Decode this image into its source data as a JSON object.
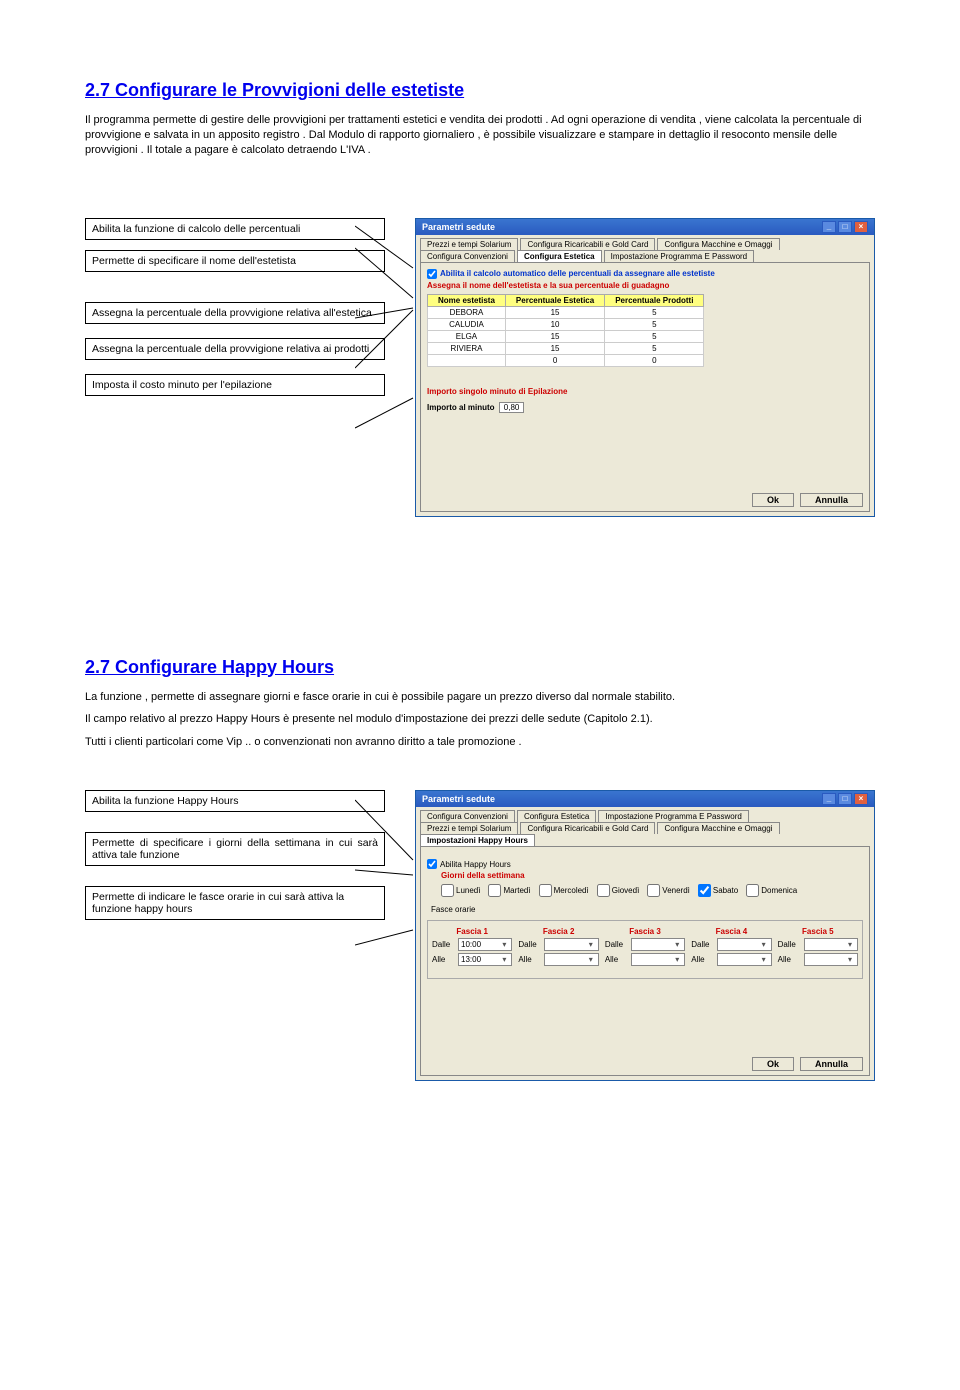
{
  "section1": {
    "heading": "2.7 Configurare le Provvigioni delle estetiste",
    "para": "Il programma permette di gestire delle provvigioni per trattamenti estetici e vendita dei prodotti . Ad ogni operazione di vendita , viene calcolata la percentuale di provvigione e salvata in un apposito registro . Dal Modulo di rapporto giornaliero , è possibile  visualizzare e stampare in dettaglio il resoconto mensile delle provvigioni . Il totale a pagare è calcolato detraendo L'IVA .",
    "callouts": {
      "c1": "Abilita la funzione di calcolo delle percentuali",
      "c2": "Permette di specificare il nome dell'estetista",
      "c3": "Assegna la percentuale della provvigione relativa all'estetica",
      "c4": "Assegna la percentuale della provvigione relativa ai prodotti",
      "c5": "Imposta il costo minuto per l'epilazione"
    },
    "win": {
      "title": "Parametri sedute",
      "tabsTop": [
        "Prezzi e tempi Solarium",
        "Configura Ricaricabili e Gold Card",
        "Configura Macchine e Omaggi"
      ],
      "tabsBottom": [
        "Configura Convenzioni",
        "Configura Estetica",
        "Impostazione Programma E Password"
      ],
      "activeTab": "Configura Estetica",
      "chk": "Abilita il calcolo automatico delle percentuali da assegnare alle estetiste",
      "redline": "Assegna il nome dell'estetista e la sua percentuale di guadagno",
      "th1": "Nome estetista",
      "th2": "Percentuale Estetica",
      "th3": "Percentuale Prodotti",
      "rows": [
        {
          "n": "DEBORA",
          "e": "15",
          "p": "5"
        },
        {
          "n": "CALUDIA",
          "e": "10",
          "p": "5"
        },
        {
          "n": "ELGA",
          "e": "15",
          "p": "5"
        },
        {
          "n": "RIVIERA",
          "e": "15",
          "p": "5"
        },
        {
          "n": "",
          "e": "0",
          "p": "0"
        }
      ],
      "importoTitle": "Importo singolo minuto di Epilazione",
      "importoLbl": "Importo al minuto",
      "importoVal": "0,80",
      "ok": "Ok",
      "cancel": "Annulla"
    }
  },
  "section2": {
    "heading": "2.7 Configurare Happy Hours",
    "para1": "La funzione , permette di assegnare giorni e fasce orarie in cui è possibile pagare un prezzo diverso dal normale stabilito.",
    "para2": "Il campo relativo al prezzo Happy Hours è presente nel modulo d'impostazione dei prezzi delle sedute (Capitolo 2.1).",
    "para3": "Tutti i clienti particolari come Vip .. o convenzionati non avranno diritto a tale promozione .",
    "callouts": {
      "c1": "Abilita la funzione Happy Hours",
      "c2": "Permette di specificare i giorni della settimana in cui sarà attiva tale funzione",
      "c3": "Permette di indicare le fasce orarie in cui sarà attiva la funzione happy hours"
    },
    "win": {
      "title": "Parametri sedute",
      "tabsTop": [
        "Configura Convenzioni",
        "Configura Estetica",
        "Impostazione Programma E Password"
      ],
      "tabsBottom": [
        "Prezzi e tempi Solarium",
        "Configura Ricaricabili e Gold Card",
        "Configura Macchine e Omaggi"
      ],
      "activeTab": "Impostazioni Happy Hours",
      "chk": "Abilita Happy Hours",
      "giorni": "Giorni della settimana",
      "days": [
        "Lunedì",
        "Martedì",
        "Mercoledì",
        "Giovedì",
        "Venerdì",
        "Sabato",
        "Domenica"
      ],
      "checked": [
        false,
        false,
        false,
        false,
        false,
        true,
        false
      ],
      "fasceLbl": "Fasce orarie",
      "fasce": [
        "Fascia 1",
        "Fascia 2",
        "Fascia 3",
        "Fascia 4",
        "Fascia 5"
      ],
      "dalle": "Dalle",
      "alle": "Alle",
      "f1dalle": "10:00",
      "f1alle": "13:00",
      "ok": "Ok",
      "cancel": "Annulla"
    }
  }
}
